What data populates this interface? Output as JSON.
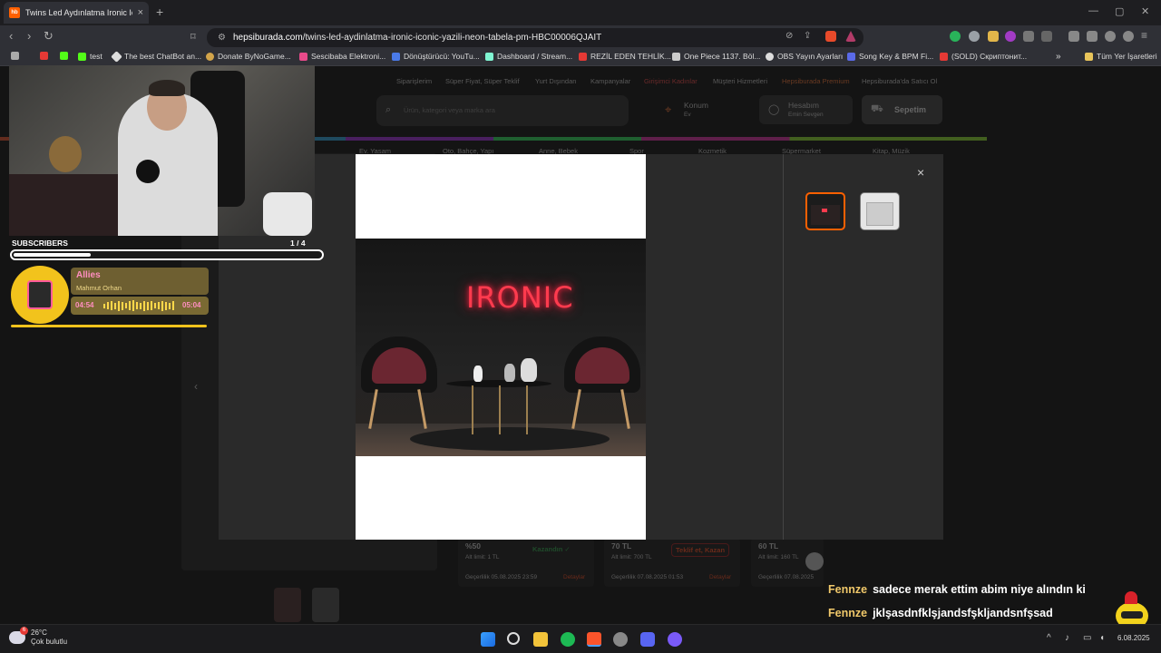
{
  "browser": {
    "tab_title": "Twins Led Aydınlatma Ironic Icon",
    "tab_favicon_text": "hb",
    "url_host": "hepsiburada.com",
    "url_path": "/twins-led-aydinlatma-ironic-iconic-yazili-neon-tabela-pm-HBC00006QJAIT",
    "bookmarks": [
      "test",
      "The best ChatBot an...",
      "Donate ByNoGame...",
      "Sescibaba Elektroni...",
      "Dönüştürücü: YouTu...",
      "Dashboard / Stream...",
      "REZİL EDEN TEHLİK...",
      "One Piece 1137. Böl...",
      "OBS Yayın Ayarları",
      "Song Key & BPM Fi...",
      "(SOLD) Скриптонит..."
    ],
    "bookmarks_all": "Tüm Yer İşaretleri"
  },
  "page_bg": {
    "nav_links": [
      "Siparişlerim",
      "Süper Fiyat, Süper Teklif",
      "Yurt Dışından",
      "Kampanyalar",
      "Girişimci Kadınlar",
      "Müşteri Hizmetleri",
      "Hepsiburada Premium",
      "Hepsiburada'da Satıcı Ol"
    ],
    "search_placeholder": "Ürün, kategori veya marka ara",
    "location_label": "Konum",
    "location_sub": "Ev",
    "account_label": "Hesabım",
    "account_sub": "Emin Sevgen",
    "cart_label": "Sepetim",
    "categories": [
      "Ev, Yaşam",
      "Oto, Bahçe, Yapı",
      "Anne, Bebek",
      "Spor",
      "Kozmetik",
      "Süpermarket",
      "Kitap, Müzik"
    ],
    "offers": [
      {
        "price": "%50",
        "note": "Kazandın ✓",
        "all_time": "Alt limit: 1 TL",
        "date": "Geçerlilik 05.08.2025 23:59",
        "link": "Detaylar"
      },
      {
        "price": "70 TL",
        "note": "Teklif et, Kazan",
        "all_time": "Alt limit: 700 TL",
        "date": "Geçerlilik 07.08.2025 01:53",
        "link": "Detaylar"
      },
      {
        "price": "60 TL",
        "note": "",
        "all_time": "Alt limit: 160 TL",
        "date": "Geçerlilik 07.08.2025",
        "link": ""
      }
    ]
  },
  "modal": {
    "product_text": "IRONIC",
    "close_label": "×",
    "thumbnails": 2
  },
  "overlay": {
    "subscribers_label": "SUBSCRIBERS",
    "subscribers_current": "1",
    "subscribers_goal": "/ 4",
    "subscribers_progress": 0.25,
    "song_title": "Allies",
    "song_artist": "Mahmut Orhan",
    "time_elapsed": "04:54",
    "time_total": "05:04"
  },
  "chat": [
    {
      "user": "Fennze",
      "message": "sadece merak ettim abim niye alındın ki"
    },
    {
      "user": "Fennze",
      "message": "jklşasdnfklşjandsfşkljandsnfşsad"
    }
  ],
  "taskbar": {
    "temperature": "26°C",
    "weather": "Çok bulutlu",
    "notification_badge": "6",
    "clock": "6.08.2025"
  },
  "colors": {
    "brand_orange": "#ff6000",
    "neon_red": "#ff3b4e",
    "overlay_yellow": "#f2c31c",
    "song_pink": "#ff8ec0",
    "chat_user": "#f0c86a"
  }
}
